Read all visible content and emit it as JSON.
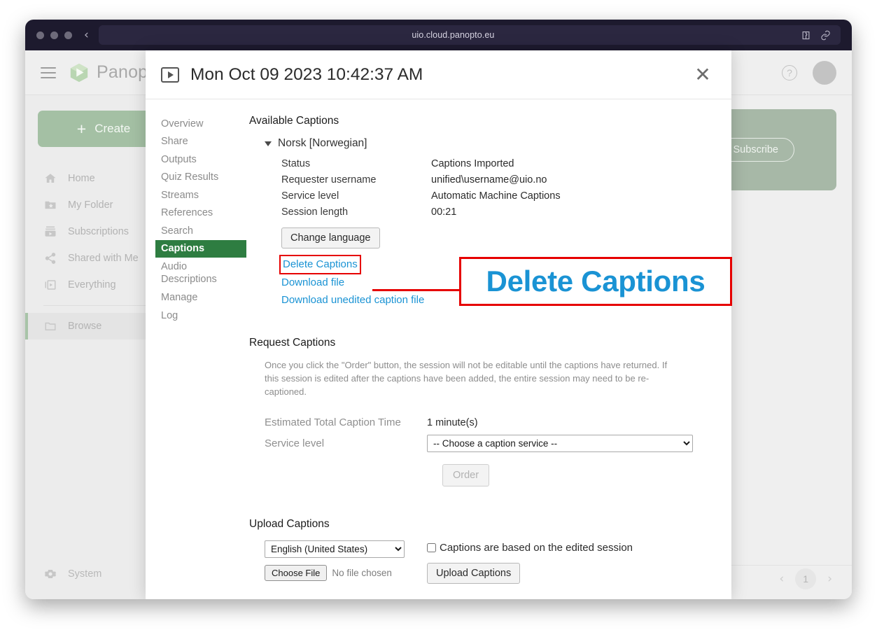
{
  "browser": {
    "url": "uio.cloud.panopto.eu",
    "back_label": "‹",
    "icons": [
      "extensions-icon",
      "link-icon"
    ]
  },
  "app": {
    "brand_name": "Panopto",
    "create_label": "Create",
    "nav_items": [
      {
        "label": "Home",
        "icon": "home-icon"
      },
      {
        "label": "My Folder",
        "icon": "folder-star-icon"
      },
      {
        "label": "Subscriptions",
        "icon": "subscriptions-icon"
      },
      {
        "label": "Shared with Me",
        "icon": "share-icon"
      },
      {
        "label": "Everything",
        "icon": "everything-icon"
      },
      {
        "label": "Browse",
        "icon": "browse-folder-icon"
      }
    ],
    "system_label": "System",
    "subscribe_label": "Subscribe",
    "help_label": "?",
    "pagination": {
      "page": "1",
      "prev": "‹",
      "next": "›"
    }
  },
  "modal": {
    "title": "Mon Oct 09 2023 10:42:37 AM",
    "close_label": "✕",
    "nav_items": [
      "Overview",
      "Share",
      "Outputs",
      "Quiz Results",
      "Streams",
      "References",
      "Search",
      "Captions",
      "Audio Descriptions",
      "Manage",
      "Log"
    ],
    "active_nav": "Captions",
    "available": {
      "heading": "Available Captions",
      "language": "Norsk [Norwegian]",
      "details": [
        {
          "label": "Status",
          "value": "Captions Imported"
        },
        {
          "label": "Requester username",
          "value": "unified\\username@uio.no"
        },
        {
          "label": "Service level",
          "value": "Automatic Machine Captions"
        },
        {
          "label": "Session length",
          "value": "00:21"
        }
      ],
      "change_language_label": "Change language",
      "links": [
        "Delete Captions",
        "Download file",
        "Download unedited caption file"
      ]
    },
    "annotation": {
      "callout_text": "Delete Captions",
      "highlight_color": "#e60000",
      "link_color": "#1a93d4"
    },
    "request": {
      "heading": "Request Captions",
      "note": "Once you click the \"Order\" button, the session will not be editable until the captions have returned. If this session is edited after the captions have been added, the entire session may need to be re-captioned.",
      "estimated_label": "Estimated Total Caption Time",
      "estimated_value": "1 minute(s)",
      "service_label": "Service level",
      "service_selected": "-- Choose a caption service --",
      "order_label": "Order"
    },
    "upload": {
      "heading": "Upload Captions",
      "language_selected": "English (United States)",
      "choose_file_label": "Choose File",
      "no_file_label": "No file chosen",
      "checkbox_label": "Captions are based on the edited session",
      "upload_button_label": "Upload Captions"
    }
  }
}
